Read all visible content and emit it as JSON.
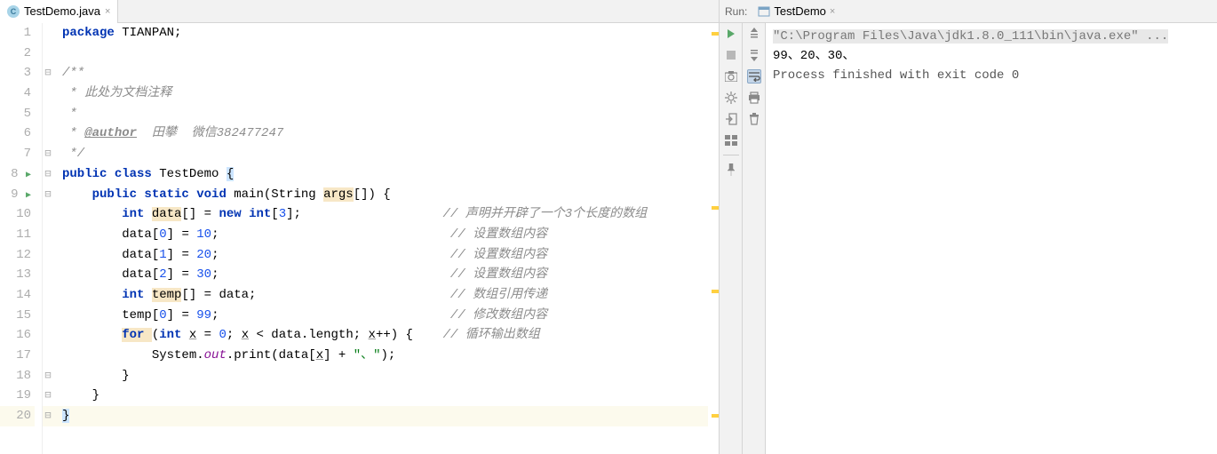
{
  "editor": {
    "tab": {
      "filename": "TestDemo.java",
      "icon_letter": "C"
    },
    "lines": [
      1,
      2,
      3,
      4,
      5,
      6,
      7,
      8,
      9,
      10,
      11,
      12,
      13,
      14,
      15,
      16,
      17,
      18,
      19,
      20
    ],
    "code": {
      "l1_package": "package ",
      "l1_pkg_name": "TIANPAN",
      "l3_doc_open": "/**",
      "l4_doc": " * 此处为文档注释",
      "l5_doc": " *",
      "l6_doc_prefix": " * ",
      "l6_tag": "@author",
      "l6_author": "  田攀  微信382477247",
      "l7_doc_close": " */",
      "l8_public": "public ",
      "l8_class": "class ",
      "l8_classname": "TestDemo ",
      "l8_brace": "{",
      "l9_public": "public ",
      "l9_static": "static ",
      "l9_void": "void ",
      "l9_main": "main(String ",
      "l9_args": "args",
      "l9_rest": "[]) {",
      "l10_int": "int ",
      "l10_data": "data",
      "l10_arr": "[] = ",
      "l10_new": "new ",
      "l10_int2": "int",
      "l10_bracket_open": "[",
      "l10_3": "3",
      "l10_bracket_close": "];",
      "l10_comment": "// 声明并开辟了一个3个长度的数组",
      "l11_data": "data[",
      "l11_0": "0",
      "l11_eq": "] = ",
      "l11_10": "10",
      "l11_semi": ";",
      "l11_comment": "// 设置数组内容",
      "l12_data": "data[",
      "l12_1": "1",
      "l12_eq": "] = ",
      "l12_20": "20",
      "l12_semi": ";",
      "l12_comment": "// 设置数组内容",
      "l13_data": "data[",
      "l13_2": "2",
      "l13_eq": "] = ",
      "l13_30": "30",
      "l13_semi": ";",
      "l13_comment": "// 设置数组内容",
      "l14_int": "int ",
      "l14_temp": "temp",
      "l14_rest": "[] = data;",
      "l14_comment": "// 数组引用传递",
      "l15_temp": "temp[",
      "l15_0": "0",
      "l15_eq": "] = ",
      "l15_99": "99",
      "l15_semi": ";",
      "l15_comment": "// 修改数组内容",
      "l16_for": "for ",
      "l16_int": "int ",
      "l16_x1": "x",
      "l16_eq": " = ",
      "l16_0": "0",
      "l16_semi1": "; ",
      "l16_x2": "x",
      "l16_lt": " < data.",
      "l16_len": "length",
      "l16_semi2": "; ",
      "l16_x3": "x",
      "l16_inc": "++) {",
      "l16_comment": "// 循环输出数组",
      "l17_sys": "System.",
      "l17_out": "out",
      "l17_print": ".print(data[",
      "l17_x": "x",
      "l17_plus": "] + ",
      "l17_str": "\"、\"",
      "l17_close": ");",
      "l18_brace": "}",
      "l19_brace": "}",
      "l20_brace": "}"
    }
  },
  "run": {
    "header_label": "Run:",
    "config_name": "TestDemo",
    "console": {
      "cmd": "\"C:\\Program Files\\Java\\jdk1.8.0_111\\bin\\java.exe\" ...",
      "output": "99、20、30、",
      "exit": "Process finished with exit code 0"
    }
  }
}
